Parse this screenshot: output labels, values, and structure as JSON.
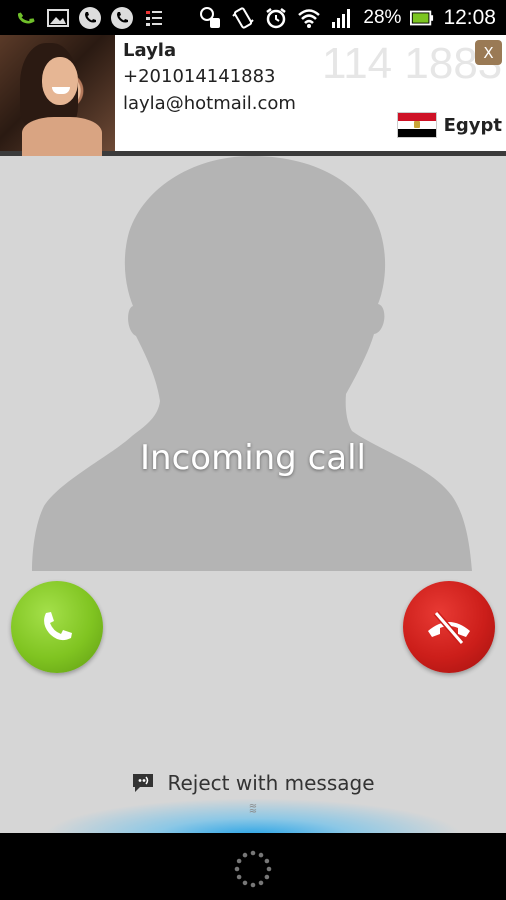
{
  "status_bar": {
    "battery_percent": "28%",
    "time": "12:08"
  },
  "contact": {
    "name": "Layla",
    "phone": "+201014141883",
    "email": "layla@hotmail.com",
    "watermark": "114 1883",
    "close_label": "X",
    "country": "Egypt"
  },
  "call": {
    "status": "Incoming call",
    "reject_with_message": "Reject with message"
  },
  "colors": {
    "answer": "#80c421",
    "decline": "#cc1e1a",
    "glow": "#1ea0e6"
  }
}
